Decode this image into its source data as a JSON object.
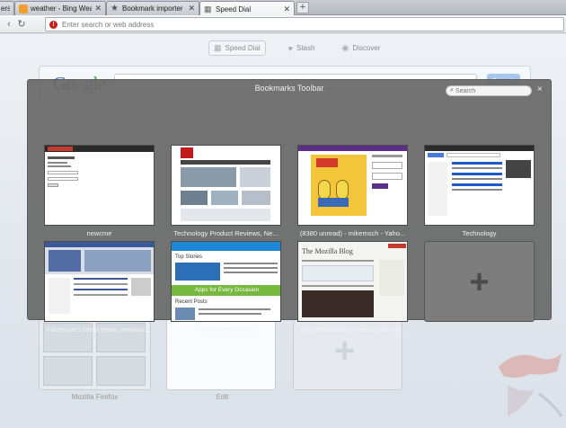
{
  "tabs": [
    {
      "title": "ers",
      "active": false
    },
    {
      "title": "weather - Bing Weather",
      "active": false
    },
    {
      "title": "Bookmark importer",
      "active": false
    },
    {
      "title": "Speed Dial",
      "active": true
    }
  ],
  "address_bar": {
    "placeholder": "Enter search or web address"
  },
  "speed_dial_nav": [
    {
      "label": "Speed Dial",
      "icon": "grid-icon",
      "active": true
    },
    {
      "label": "Stash",
      "icon": "heart-icon",
      "active": false
    },
    {
      "label": "Discover",
      "icon": "eye-icon",
      "active": false
    }
  ],
  "google": {
    "logo_letters": [
      "G",
      "o",
      "o",
      "g",
      "l",
      "e"
    ],
    "button": "Search"
  },
  "background_tiles": [
    {
      "label": "Mozilla Firefox"
    },
    {
      "label": "Edit"
    }
  ],
  "overlay": {
    "title": "Bookmarks Toolbar",
    "search_placeholder": "Search",
    "close": "×",
    "tiles": [
      {
        "label": "newcme"
      },
      {
        "label": "Technology Product Reviews, Ne..."
      },
      {
        "label": "(8380 unread) - mikemsch - Yaho..."
      },
      {
        "label": "Technology"
      },
      {
        "label": "Facebook's latest news, announc..."
      },
      {
        "label": "The Windows Blog"
      },
      {
        "label": "The Mozilla Blog | News, notes an..."
      }
    ],
    "windows_blog_banner": "Apps for Every Occasion",
    "windows_blog_top": "Top Stories",
    "windows_blog_recent": "Recent Posts",
    "mozilla_blog_title": "The Mozilla Blog"
  },
  "colors": {
    "overlay_bg": "#686868",
    "google_button": "#a9c6ef",
    "windows_green": "#77b83f"
  }
}
